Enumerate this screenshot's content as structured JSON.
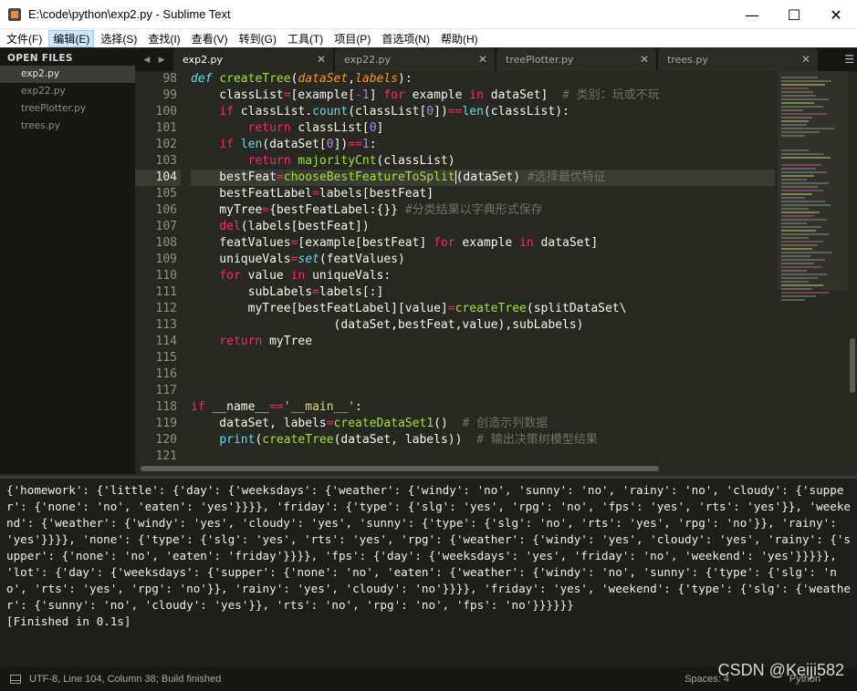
{
  "window": {
    "title": "E:\\code\\python\\exp2.py - Sublime Text",
    "minimize": "—",
    "maximize": "☐",
    "close": "✕"
  },
  "menu": [
    "文件(F)",
    "编辑(E)",
    "选择(S)",
    "查找(I)",
    "查看(V)",
    "转到(G)",
    "工具(T)",
    "项目(P)",
    "首选项(N)",
    "帮助(H)"
  ],
  "sidebar": {
    "header": "OPEN FILES",
    "files": [
      "exp2.py",
      "exp22.py",
      "treePlotter.py",
      "trees.py"
    ]
  },
  "tabs": [
    "exp2.py",
    "exp22.py",
    "treePlotter.py",
    "trees.py"
  ],
  "editor": {
    "line_numbers": [
      "98",
      "99",
      "100",
      "101",
      "102",
      "103",
      "104",
      "105",
      "106",
      "107",
      "108",
      "109",
      "110",
      "111",
      "112",
      "113",
      "114",
      "115",
      "116",
      "117",
      "118",
      "119",
      "120",
      "121"
    ],
    "current_line": "104"
  },
  "console": {
    "output": "{'homework': {'little': {'day': {'weeksdays': {'weather': {'windy': 'no', 'sunny': 'no', 'rainy': 'no', 'cloudy': {'supper': {'none': 'no', 'eaten': 'yes'}}}}, 'friday': {'type': {'slg': 'yes', 'rpg': 'no', 'fps': 'yes', 'rts': 'yes'}}, 'weekend': {'weather': {'windy': 'yes', 'cloudy': 'yes', 'sunny': {'type': {'slg': 'no', 'rts': 'yes', 'rpg': 'no'}}, 'rainy': 'yes'}}}}, 'none': {'type': {'slg': 'yes', 'rts': 'yes', 'rpg': {'weather': {'windy': 'yes', 'cloudy': 'yes', 'rainy': {'supper': {'none': 'no', 'eaten': 'friday'}}}}, 'fps': {'day': {'weeksdays': 'yes', 'friday': 'no', 'weekend': 'yes'}}}}}, 'lot': {'day': {'weeksdays': {'supper': {'none': 'no', 'eaten': {'weather': {'windy': 'no', 'sunny': {'type': {'slg': 'no', 'rts': 'yes', 'rpg': 'no'}}, 'rainy': 'yes', 'cloudy': 'no'}}}}, 'friday': 'yes', 'weekend': {'type': {'slg': {'weather': {'sunny': 'no', 'cloudy': 'yes'}}, 'rts': 'no', 'rpg': 'no', 'fps': 'no'}}}}}}",
    "finished": "[Finished in 0.1s]"
  },
  "status": {
    "text": "UTF-8, Line 104, Column 38; Build finished",
    "spaces": "Spaces: 4",
    "syntax": "Python",
    "watermark": "CSDN @Keiji582"
  },
  "colors": {
    "background": "#272822",
    "keyword": "#f92672",
    "function": "#a6e22e",
    "builtin": "#66d9ef",
    "string": "#e6db74",
    "number": "#ae81ff",
    "comment": "#75715e",
    "parameter": "#fd971f"
  }
}
